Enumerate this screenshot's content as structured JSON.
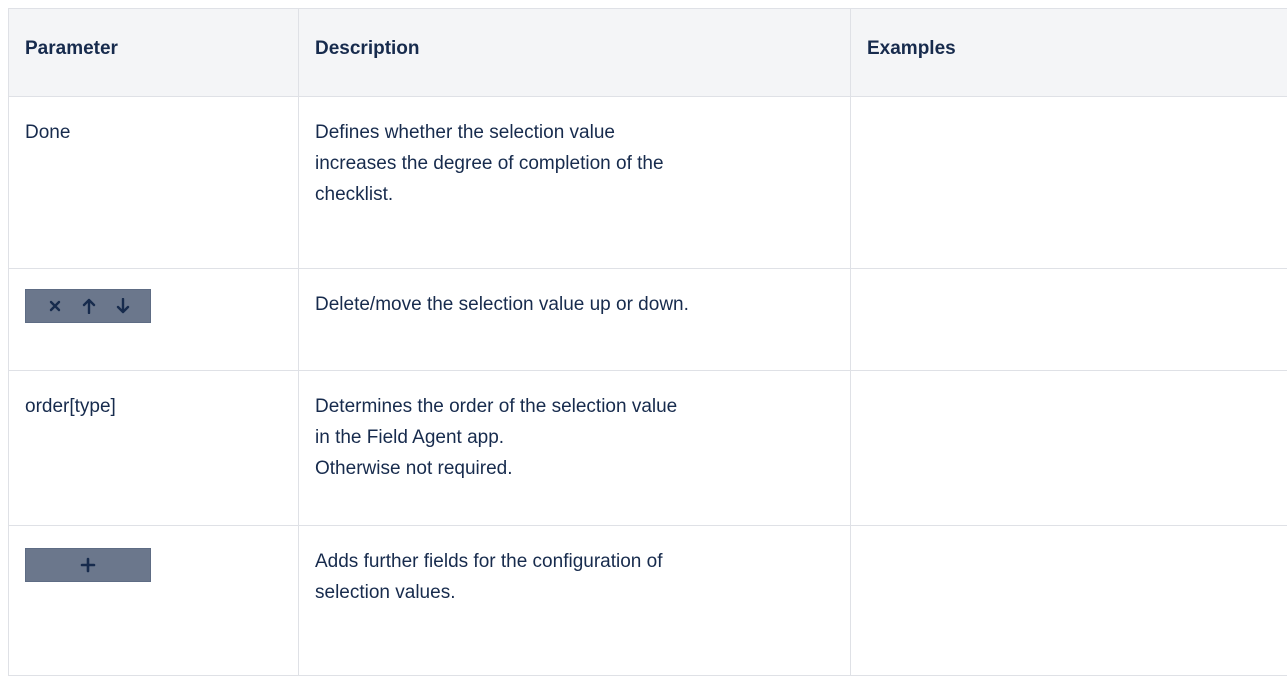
{
  "table": {
    "headers": {
      "parameter": "Parameter",
      "description": "Description",
      "examples": "Examples"
    },
    "rows": [
      {
        "parameter": "Done",
        "description": [
          "Defines whether the selection value",
          "increases the degree of completion of the",
          "checklist."
        ],
        "examples": ""
      },
      {
        "parameter_icons": [
          "close-icon",
          "arrow-up-icon",
          "arrow-down-icon"
        ],
        "description": [
          "Delete/move the selection value up or down."
        ],
        "examples": ""
      },
      {
        "parameter": "order[type]",
        "description": [
          "Determines the order of the selection value",
          "in the Field Agent app.",
          "Otherwise not required."
        ],
        "examples": ""
      },
      {
        "parameter_icons": [
          "plus-icon"
        ],
        "description": [
          "Adds further fields for the configuration of",
          "selection values."
        ],
        "examples": ""
      }
    ]
  },
  "colors": {
    "header_bg": "#f4f5f7",
    "border": "#dfe1e6",
    "button_strip": "#6b778c",
    "text": "#172b4d"
  }
}
